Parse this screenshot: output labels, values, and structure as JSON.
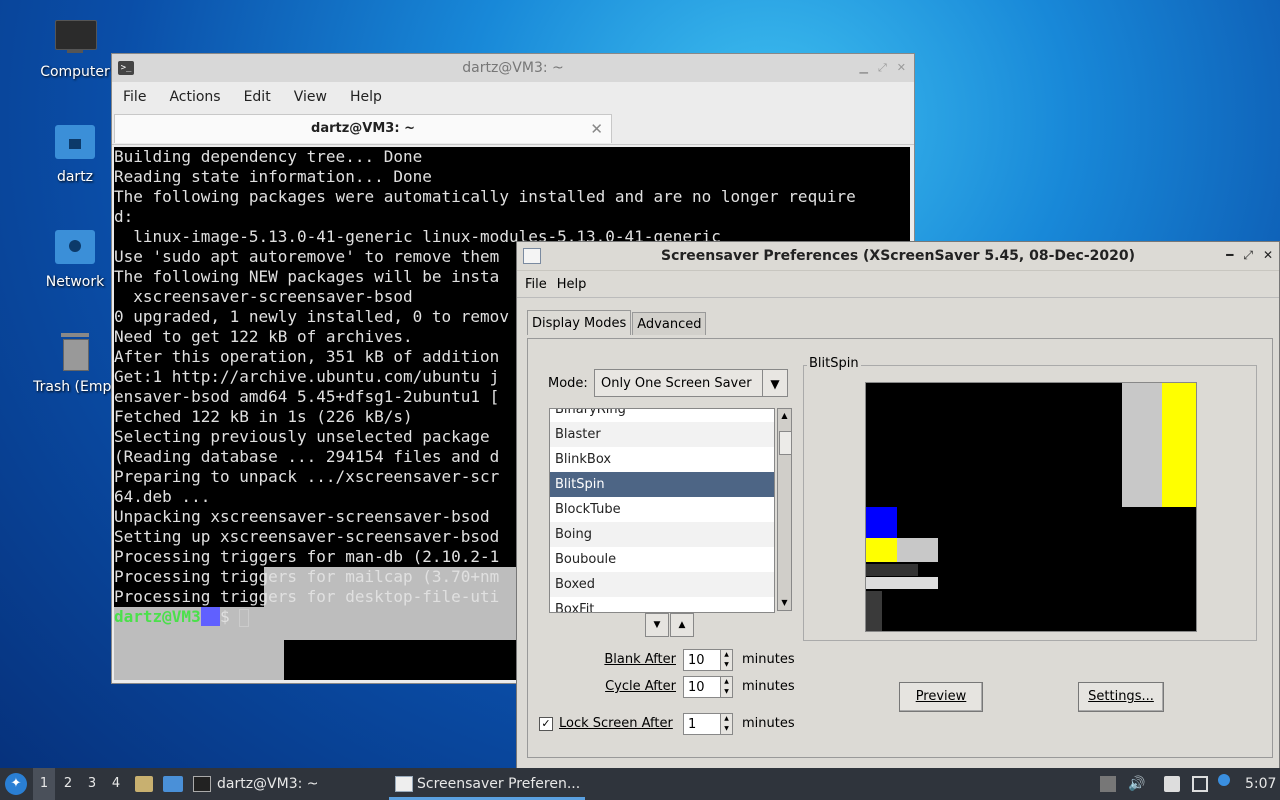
{
  "desktop": {
    "icons": [
      {
        "label": "Computer"
      },
      {
        "label": "dartz"
      },
      {
        "label": "Network"
      },
      {
        "label": "Trash (Empt"
      }
    ]
  },
  "terminal": {
    "title": "dartz@VM3: ~",
    "menu": [
      "File",
      "Actions",
      "Edit",
      "View",
      "Help"
    ],
    "tab_label": "dartz@VM3: ~",
    "lines": [
      "Building dependency tree... Done",
      "Reading state information... Done",
      "The following packages were automatically installed and are no longer require",
      "d:",
      "  linux-image-5.13.0-41-generic linux-modules-5.13.0-41-generic",
      "Use 'sudo apt autoremove' to remove them",
      "The following NEW packages will be insta",
      "  xscreensaver-screensaver-bsod",
      "0 upgraded, 1 newly installed, 0 to remov",
      "Need to get 122 kB of archives.",
      "After this operation, 351 kB of addition",
      "Get:1 http://archive.ubuntu.com/ubuntu j",
      "ensaver-bsod amd64 5.45+dfsg1-2ubuntu1 [",
      "Fetched 122 kB in 1s (226 kB/s)",
      "Selecting previously unselected package",
      "(Reading database ... 294154 files and d",
      "Preparing to unpack .../xscreensaver-scr",
      "64.deb ...",
      "Unpacking xscreensaver-screensaver-bsod",
      "Setting up xscreensaver-screensaver-bsod",
      "Processing triggers for man-db (2.10.2-1",
      "Processing triggers for mailcap (3.70+nm",
      "Processing triggers for desktop-file-uti"
    ],
    "prompt_user": "dartz@VM3",
    "prompt_path": ":~",
    "prompt_suffix": "$ "
  },
  "xscreensaver": {
    "title": "Screensaver Preferences  (XScreenSaver 5.45, 08-Dec-2020)",
    "menu": [
      "File",
      "Help"
    ],
    "tabs": [
      "Display Modes",
      "Advanced"
    ],
    "mode_label": "Mode:",
    "mode_value": "Only One Screen Saver",
    "list": [
      "BinaryRing",
      "Blaster",
      "BlinkBox",
      "BlitSpin",
      "BlockTube",
      "Boing",
      "Bouboule",
      "Boxed",
      "BoxFit"
    ],
    "selected": "BlitSpin",
    "preview_title": "BlitSpin",
    "blank_after_label": "Blank After",
    "blank_after_value": "10",
    "cycle_after_label": "Cycle After",
    "cycle_after_value": "10",
    "lock_label": "Lock Screen After",
    "lock_value": "1",
    "lock_checked": true,
    "unit": "minutes",
    "preview_button": "Preview",
    "settings_button": "Settings..."
  },
  "taskbar": {
    "workspaces": [
      "1",
      "2",
      "3",
      "4"
    ],
    "tasks": [
      "dartz@VM3: ~",
      "Screensaver Preferen..."
    ],
    "clock": "5:07"
  }
}
